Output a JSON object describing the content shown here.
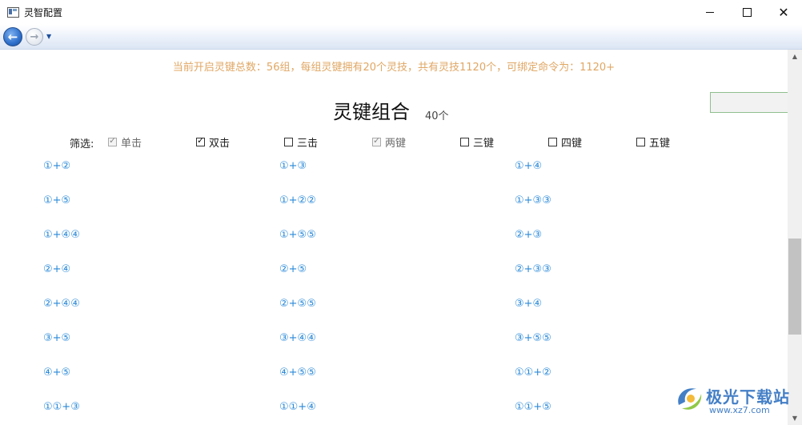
{
  "window": {
    "title": "灵智配置",
    "minimize_icon": "minimize-icon",
    "maximize_icon": "maximize-icon",
    "close_icon": "close-icon",
    "close_glyph": "✕"
  },
  "nav": {
    "back_glyph": "←",
    "forward_glyph": "→",
    "dropdown_glyph": "▼"
  },
  "summary": "当前开启灵键总数：56组，每组灵键拥有20个灵技，共有灵技1120个，可绑定命令为：1120+",
  "heading": "灵键组合",
  "count": "40个",
  "filter": {
    "label": "筛选:",
    "options": [
      {
        "label": "单击",
        "checked": true,
        "disabled": true
      },
      {
        "label": "双击",
        "checked": true,
        "disabled": false
      },
      {
        "label": "三击",
        "checked": false,
        "disabled": false
      },
      {
        "label": "两键",
        "checked": true,
        "disabled": true
      },
      {
        "label": "三键",
        "checked": false,
        "disabled": false
      },
      {
        "label": "四键",
        "checked": false,
        "disabled": false
      },
      {
        "label": "五键",
        "checked": false,
        "disabled": false
      }
    ]
  },
  "combos": [
    [
      "①+②",
      "①+③",
      "①+④"
    ],
    [
      "①+⑤",
      "①+②②",
      "①+③③"
    ],
    [
      "①+④④",
      "①+⑤⑤",
      "②+③"
    ],
    [
      "②+④",
      "②+⑤",
      "②+③③"
    ],
    [
      "②+④④",
      "②+⑤⑤",
      "③+④"
    ],
    [
      "③+⑤",
      "③+④④",
      "③+⑤⑤"
    ],
    [
      "④+⑤",
      "④+⑤⑤",
      "①①+②"
    ],
    [
      "①①+③",
      "①①+④",
      "①①+⑤"
    ]
  ],
  "scrollbar": {
    "up_glyph": "▲",
    "down_glyph": "▼"
  },
  "watermark": {
    "text": "极光下载站",
    "url": "www.xz7.com"
  },
  "colors": {
    "summary": "#e0a764",
    "combo_link": "#2a89d8"
  }
}
